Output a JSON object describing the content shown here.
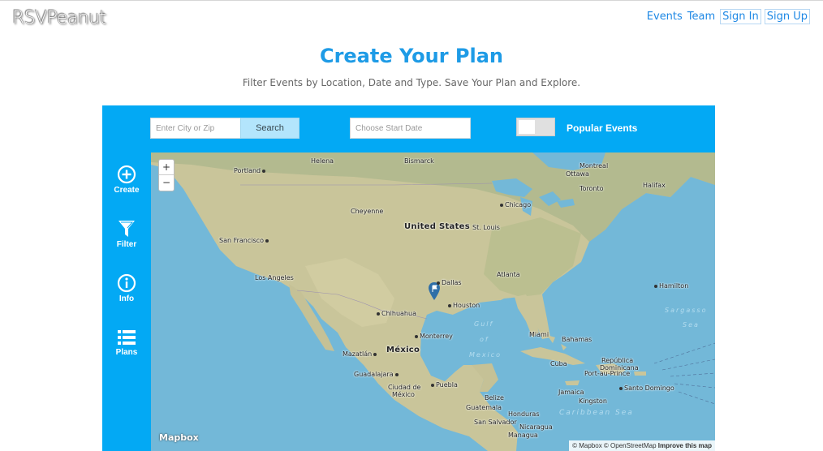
{
  "header": {
    "logo": "RSVPeanut",
    "nav": {
      "events": "Events",
      "team": "Team",
      "sign_in": "Sign In",
      "sign_up": "Sign Up"
    }
  },
  "hero": {
    "title": "Create Your Plan",
    "subtitle": "Filter Events by Location, Date and Type. Save Your Plan and Explore."
  },
  "toolbar": {
    "city_placeholder": "Enter City or Zip",
    "search_label": "Search",
    "date_placeholder": "Choose Start Date",
    "popular_label": "Popular Events",
    "popular_on": false
  },
  "sidebar": {
    "items": [
      {
        "label": "Create",
        "icon": "plus-circle-icon"
      },
      {
        "label": "Filter",
        "icon": "funnel-icon"
      },
      {
        "label": "Info",
        "icon": "info-circle-icon"
      },
      {
        "label": "Plans",
        "icon": "list-icon"
      }
    ]
  },
  "map": {
    "zoom_in": "+",
    "zoom_out": "−",
    "labels": {
      "helena": "Helena",
      "bismarck": "Bismarck",
      "montreal": "Montreal",
      "portland": "Portland",
      "ottawa": "Ottawa",
      "halifax": "Halifax",
      "toronto": "Toronto",
      "chicago": "Chicago",
      "cheyenne": "Cheyenne",
      "united_states": "United States",
      "san_francisco": "San Francisco",
      "st_louis": "St. Louis",
      "atlanta": "Atlanta",
      "los_angeles": "Los Angeles",
      "dallas": "Dallas",
      "hamilton": "Hamilton",
      "houston": "Houston",
      "chihuahua": "Chihuahua",
      "sargasso": "Sargasso",
      "sea": "Sea",
      "gulf": "Gulf",
      "of": "of",
      "mexico_gulf": "Mexico",
      "miami": "Miami",
      "monterrey": "Monterrey",
      "bahamas": "Bahamas",
      "mexico": "México",
      "mazatlan": "Mazatlán",
      "cuba": "Cuba",
      "republica": "República",
      "dominicana": "Dominicana",
      "guadalajara": "Guadalajara",
      "port_au_prince": "Port-au-Prince",
      "ciudad": "Ciudad de",
      "mexico_city": "México",
      "puebla": "Puebla",
      "santo_domingo": "Santo Domingo",
      "jamaica": "Jamaica",
      "kingston": "Kingston",
      "belize": "Belize",
      "caribbean_sea": "Caribbean Sea",
      "guatemala": "Guatemala",
      "honduras": "Honduras",
      "san_salvador": "San Salvador",
      "nicaragua": "Nicaragua",
      "managua": "Managua"
    },
    "logo": "Mapbox",
    "attribution": {
      "mapbox": "© Mapbox",
      "osm": "© OpenStreetMap",
      "improve": "Improve this map"
    }
  },
  "colors": {
    "accent": "#03a9f4",
    "title": "#1e9be6",
    "link": "#1e88e5",
    "water": "#73b8d8",
    "land": "#c9c59a"
  }
}
